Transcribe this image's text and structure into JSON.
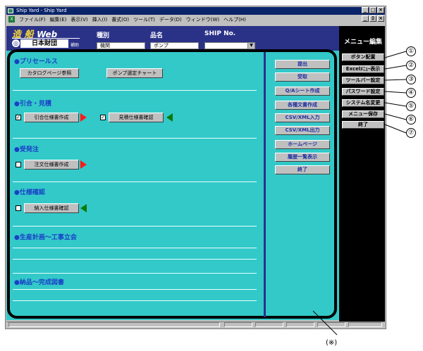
{
  "window": {
    "title": "Ship Yard - Ship Yard",
    "controls": [
      "_",
      "□",
      "×"
    ],
    "doc_controls": [
      "_",
      "ﾛ",
      "×"
    ]
  },
  "menubar": [
    "ファイル(F)",
    "編集(E)",
    "表示(V)",
    "挿入(I)",
    "書式(O)",
    "ツール(T)",
    "データ(D)",
    "ウィンドウ(W)",
    "ヘルプ(H)"
  ],
  "header": {
    "logo_text": "造 船",
    "logo_web": "Web",
    "logo_org": "日本財団",
    "logo_sub": "補助",
    "field_labels": {
      "type": "種別",
      "product": "品名",
      "ship": "SHIP No."
    },
    "field_values": {
      "type": "機関",
      "product": "ポンプ",
      "ship": ""
    }
  },
  "menu_panel": {
    "title": "メニュー編集",
    "buttons": [
      "ボタン配置",
      "Excelﾒﾆｭｰ表示",
      "ツールバー設定",
      "パスワード設定",
      "システム名変更",
      "メニュー保存",
      "終了"
    ]
  },
  "sections": [
    {
      "title": "●プリセールス",
      "buttons": [
        "カタログページ参照",
        "ポンプ選定チャート"
      ]
    },
    {
      "title": "●引合・見積",
      "buttons": [
        "引合仕様書作成",
        "見積仕様書確認"
      ]
    },
    {
      "title": "●受発注",
      "buttons": [
        "注文仕様書作成"
      ]
    },
    {
      "title": "●仕様確認",
      "buttons": [
        "納入仕様書確認"
      ]
    },
    {
      "title": "●生産計画～工事立会",
      "buttons": []
    },
    {
      "title": "●納品～完成図書",
      "buttons": []
    }
  ],
  "right_buttons": [
    "提出",
    "受取",
    "Q/Aシート作成",
    "各種文書作成",
    "CSV/XML入力",
    "CSV/XML出力",
    "ホームページ",
    "履歴一覧表示",
    "終了"
  ],
  "callouts": [
    "①",
    "②",
    "③",
    "④",
    "⑤",
    "⑥",
    "⑦"
  ],
  "note": "(※)",
  "colors": {
    "main_bg": "#33c9c9",
    "header_bg": "#2a3288",
    "section_title": "#1a3fc7",
    "arrow_red": "#ff1a1a",
    "arrow_green": "#0b7a0b"
  }
}
